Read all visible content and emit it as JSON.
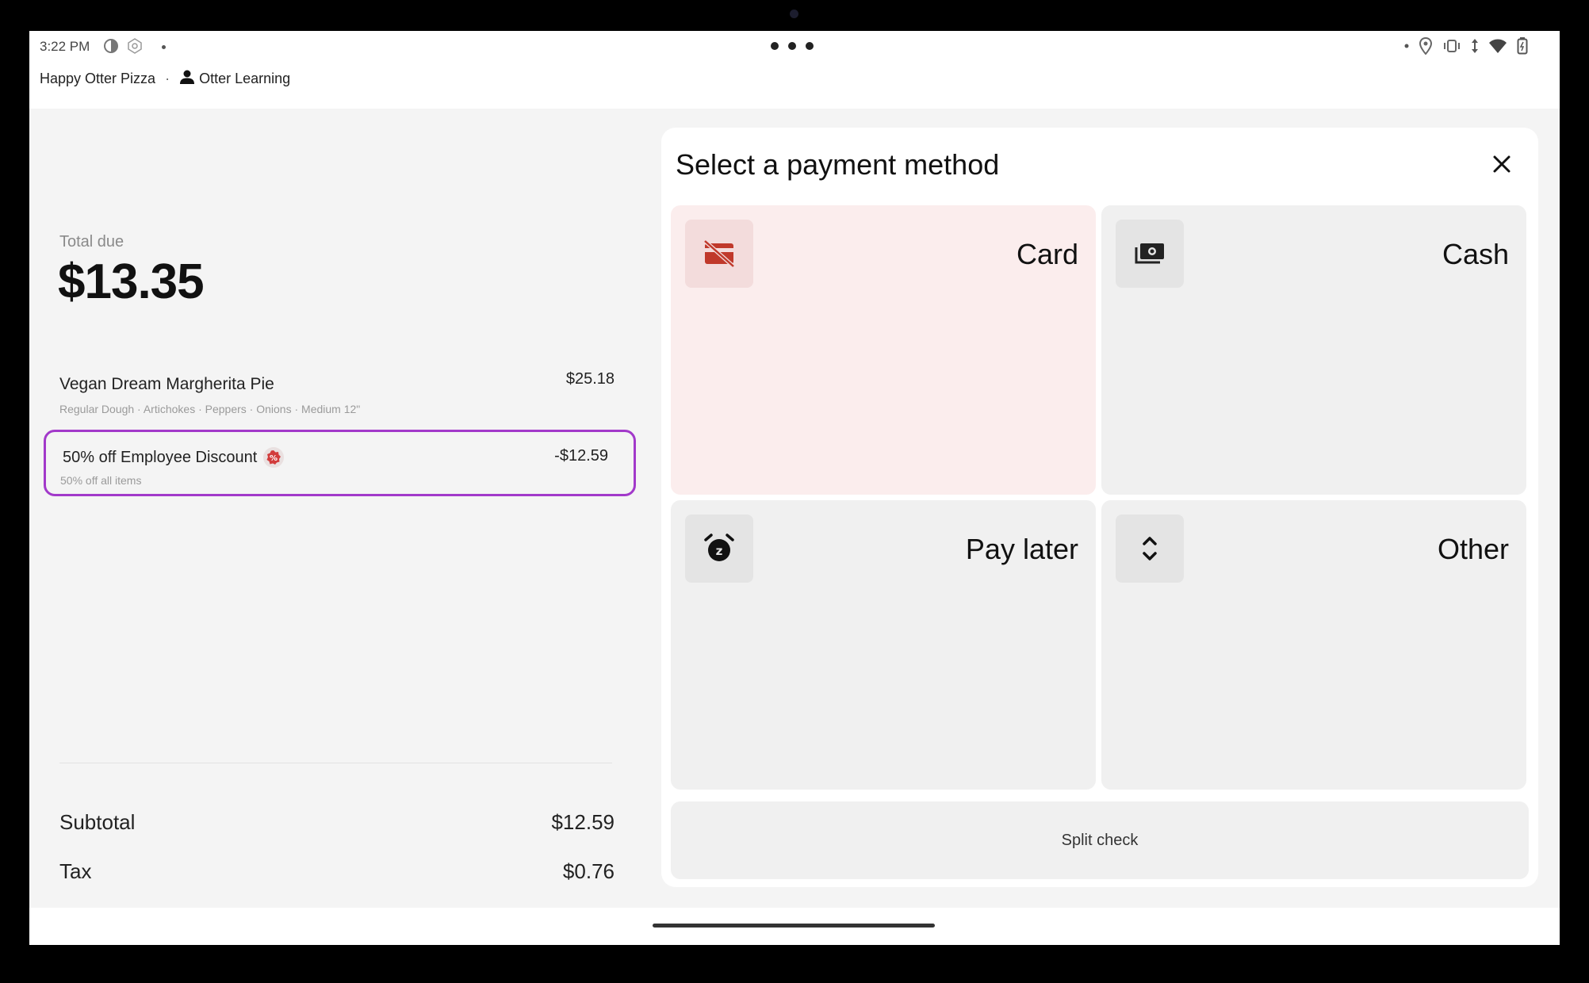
{
  "status_bar": {
    "time": "3:22 PM",
    "left_icons": [
      "battery-saver-icon",
      "app-notification-icon",
      "dot-icon"
    ],
    "center_menu": "more-dots-icon",
    "right_icons": [
      "dot-icon",
      "location-icon",
      "vibrate-icon",
      "data-arrows-icon",
      "wifi-icon",
      "battery-icon"
    ]
  },
  "header": {
    "store_name": "Happy Otter Pizza",
    "separator": "·",
    "user_name": "Otter Learning"
  },
  "order": {
    "total_label": "Total due",
    "total_value": "$13.35",
    "item": {
      "name": "Vegan Dream Margherita Pie",
      "price": "$25.18",
      "modifiers": "Regular Dough · Artichokes · Peppers · Onions · Medium 12\""
    },
    "discount": {
      "name": "50% off Employee Discount",
      "amount": "-$12.59",
      "description": "50% off all items",
      "highlight_color": "#a239ca"
    },
    "subtotal_label": "Subtotal",
    "subtotal_value": "$12.59",
    "tax_label": "Tax",
    "tax_value": "$0.76"
  },
  "payment_panel": {
    "title": "Select a payment method",
    "close_icon": "close-icon",
    "methods": [
      {
        "label": "Card",
        "icon": "card-off-icon",
        "selected": true
      },
      {
        "label": "Cash",
        "icon": "cash-icon",
        "selected": false
      },
      {
        "label": "Pay later",
        "icon": "snooze-alarm-icon",
        "selected": false
      },
      {
        "label": "Other",
        "icon": "unfold-icon",
        "selected": false
      }
    ],
    "split_check_label": "Split check"
  },
  "colors": {
    "selected_tile": "#fbeded",
    "card_icon": "#c0392b",
    "discount_badge": "#d23c3c"
  }
}
